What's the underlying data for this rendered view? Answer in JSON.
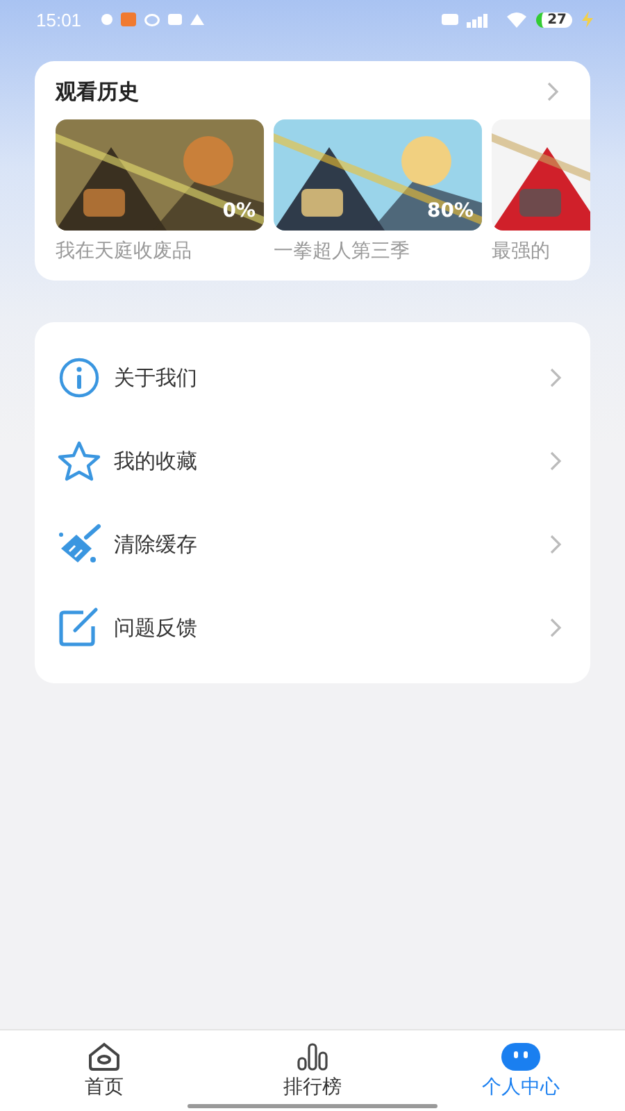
{
  "status_bar": {
    "time": "15:01",
    "battery": "27"
  },
  "history": {
    "title": "观看历史",
    "items": [
      {
        "title": "我在天庭收废品",
        "progress": "0%"
      },
      {
        "title": "一拳超人第三季",
        "progress": "80%"
      },
      {
        "title": "最强的"
      }
    ]
  },
  "menu": [
    {
      "kind": "info",
      "label": "关于我们"
    },
    {
      "kind": "star",
      "label": "我的收藏"
    },
    {
      "kind": "broom",
      "label": "清除缓存"
    },
    {
      "kind": "edit",
      "label": "问题反馈"
    }
  ],
  "tabs": [
    {
      "kind": "home",
      "label": "首页",
      "selected": false
    },
    {
      "kind": "rank",
      "label": "排行榜",
      "selected": false
    },
    {
      "kind": "me",
      "label": "个人中心",
      "selected": true
    }
  ]
}
